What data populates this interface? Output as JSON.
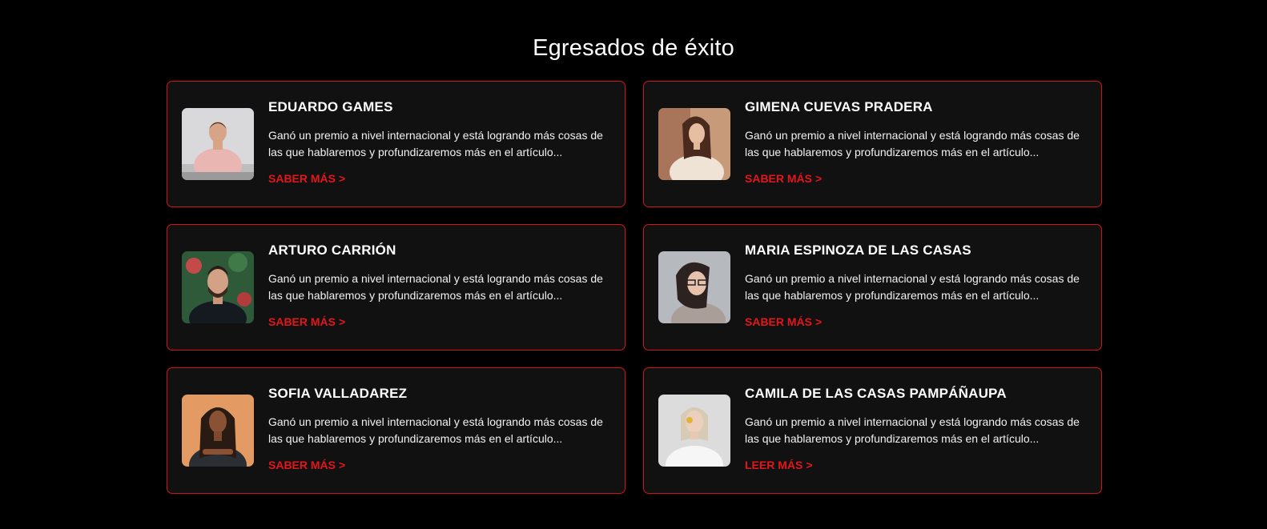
{
  "section": {
    "title": "Egresados de éxito"
  },
  "accent_color": "#e3161b",
  "graduates": [
    {
      "name": "EDUARDO GAMES",
      "description": "Ganó un premio a nivel internacional y está logrando más cosas de las que hablaremos y profundizaremos más en el artículo...",
      "cta": "SABER MÁS",
      "cta_icon": ">"
    },
    {
      "name": "GIMENA CUEVAS PRADERA",
      "description": "Ganó un premio a nivel internacional y está logrando más cosas de las que hablaremos y profundizaremos más en el artículo...",
      "cta": "SABER MÁS",
      "cta_icon": ">"
    },
    {
      "name": "ARTURO CARRIÓN",
      "description": "Ganó un premio a nivel internacional y está logrando más cosas de las que hablaremos y profundizaremos más en el artículo...",
      "cta": "SABER MÁS",
      "cta_icon": ">"
    },
    {
      "name": "MARIA ESPINOZA DE LAS CASAS",
      "description": "Ganó un premio a nivel internacional y está logrando más cosas de las que hablaremos y profundizaremos más en el artículo...",
      "cta": "SABER MÁS",
      "cta_icon": ">"
    },
    {
      "name": "SOFIA VALLADAREZ",
      "description": "Ganó un premio a nivel internacional y está logrando más cosas de las que hablaremos y profundizaremos más en el artículo...",
      "cta": "SABER MÁS",
      "cta_icon": ">"
    },
    {
      "name": "CAMILA DE LAS CASAS PAMPÁÑAUPA",
      "description": "Ganó un premio a nivel internacional y está logrando más cosas de las que hablaremos y profundizaremos más en el artículo...",
      "cta": "LEER MÁS",
      "cta_icon": ">"
    }
  ]
}
